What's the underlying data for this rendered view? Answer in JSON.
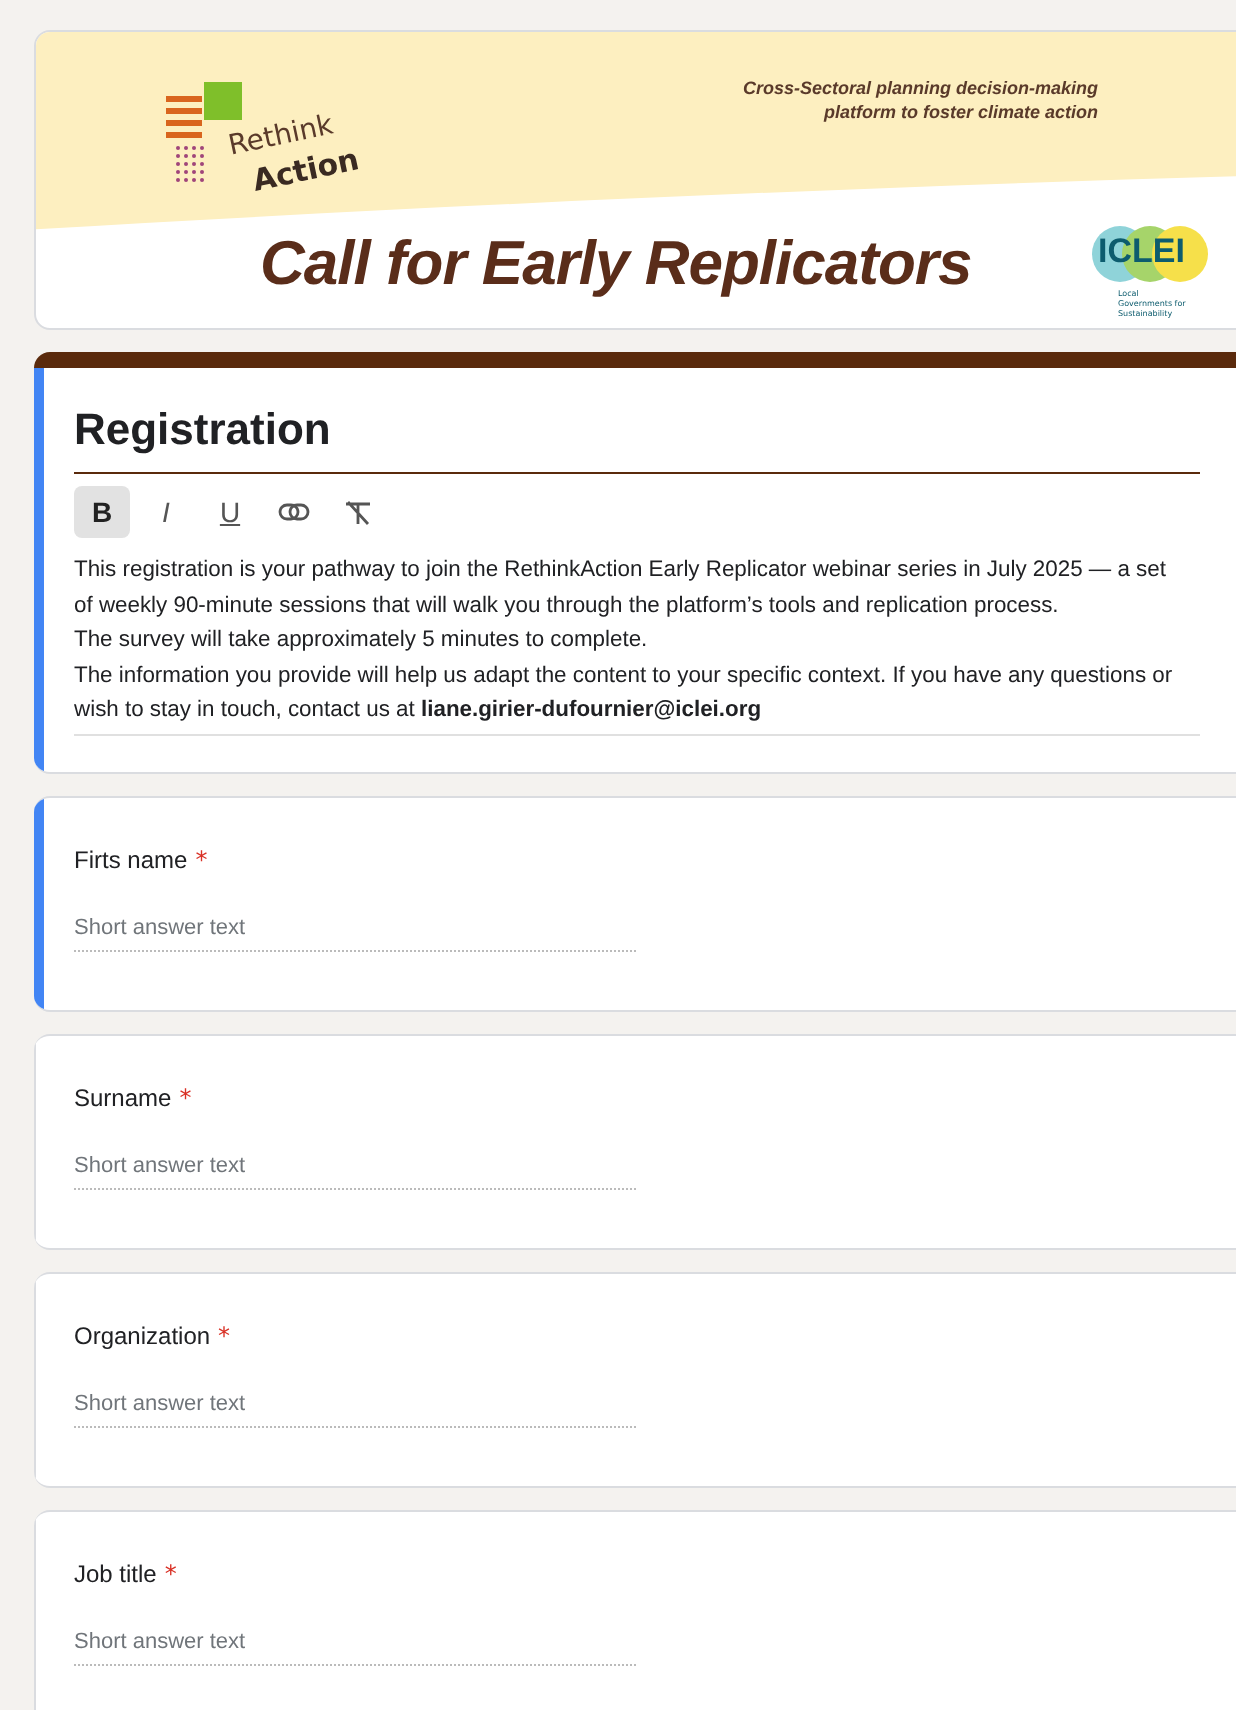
{
  "banner": {
    "logo_line_1": "Rethink",
    "logo_line_2": "Action",
    "tagline": [
      "Cross-Sectoral planning decision-making",
      "platform to foster climate action"
    ],
    "title": "Call for Early Replicators",
    "partner_logo": "ICLEI",
    "partner_subtitle": "Local Governments for Sustainability"
  },
  "section": {
    "title": "Registration",
    "selected": true,
    "toolbar": [
      {
        "kind": "bold",
        "label": "B",
        "active": true
      },
      {
        "kind": "italic",
        "label": "I",
        "active": false
      },
      {
        "kind": "underline",
        "label": "U",
        "active": false
      },
      {
        "kind": "link",
        "active": false
      },
      {
        "kind": "clear",
        "active": false
      }
    ],
    "paragraphs": [
      "This registration is your pathway to join the RethinkAction Early Replicator webinar series in July 2025 — a set of weekly 90-minute sessions that will walk you through the platform’s tools and replication process.",
      "The survey will take approximately 5 minutes to complete.",
      "The information you provide will help us adapt the content to your specific context. If you have any questions or wish to stay in touch, contact us at **liane.girier-dufournier@iclei.org**"
    ]
  },
  "questions": [
    {
      "label": "Firts name",
      "required_mark": "*",
      "placeholder": "Short answer text",
      "selected": true
    },
    {
      "label": "Surname",
      "required_mark": "*",
      "placeholder": "Short answer text",
      "selected": false
    },
    {
      "label": "Organization",
      "required_mark": "*",
      "placeholder": "Short answer text",
      "selected": false
    },
    {
      "label": "Job title",
      "required_mark": "*",
      "placeholder": "Short answer text",
      "selected": false
    }
  ]
}
